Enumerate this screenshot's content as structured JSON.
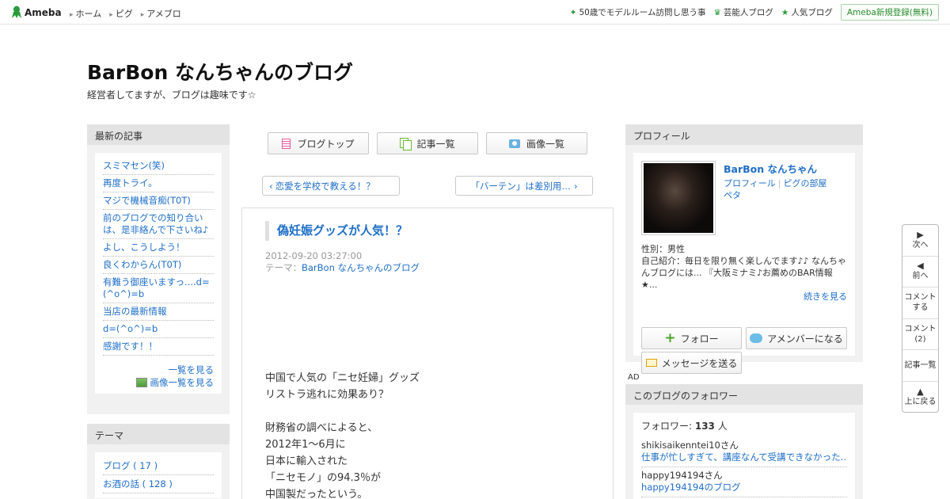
{
  "header": {
    "logo": "Ameba",
    "nav": [
      "ホーム",
      "ピグ",
      "アメブロ"
    ],
    "right_links": [
      "50歳でモデルルーム訪問し思う事",
      "芸能人ブログ",
      "人気ブログ"
    ],
    "register": "Ameba新規登録(無料)"
  },
  "blog": {
    "title": "BarBon なんちゃんのブログ",
    "description": "経営者してますが、ブログは趣味です☆"
  },
  "latest": {
    "heading": "最新の記事",
    "items": [
      "スミマセン(笑)",
      "再度トライ。",
      "マジで機械音痴(T0T)",
      "前のブログでの知り合いは、是非絡んで下さいね♪",
      "よし、こうしよう！",
      "良くわからん(T0T)",
      "有難う御座いますっ....d=(^o^)=b",
      "当店の最新情報",
      "d=(^o^)=b",
      "感謝です！！"
    ],
    "see_list": "一覧を見る",
    "see_images": "画像一覧を見る"
  },
  "theme": {
    "heading": "テーマ",
    "items": [
      "ブログ ( 17 )",
      "お酒の話 ( 128 )"
    ]
  },
  "center": {
    "tabs": [
      "ブログトップ",
      "記事一覧",
      "画像一覧"
    ],
    "prev": "恋愛を学校で教える！？",
    "next": "「バーテン」は差別用…",
    "entry": {
      "title": "偽妊娠グッズが人気！？",
      "date": "2012-09-20 03:27:00",
      "theme_label": "テーマ：",
      "theme": "BarBon なんちゃんのブログ",
      "body": [
        "中国で人気の「ニセ妊婦」グッズ",
        "リストラ逃れに効果あり？",
        "",
        "財務省の調べによると、",
        "2012年1～6月に",
        "日本に輸入された",
        "「ニセモノ」の94.3％が",
        "中国製だったという。"
      ]
    }
  },
  "profile": {
    "heading": "プロフィール",
    "name": "BarBon なんちゃん",
    "link_profile": "プロフィール",
    "link_pig": "ピグの部屋",
    "link_peta": "ペタ",
    "gender": "性別：男性",
    "intro": "自己紹介：毎日を限り無く楽しんでます♪♪ なんちゃんブログには... 『大阪ミナミ♪お薦めのBAR情報★...",
    "more": "続きを見る",
    "follow": "フォロー",
    "amember": "アメンバーになる",
    "message": "メッセージを送る"
  },
  "ad_label": "AD",
  "followers": {
    "heading": "このブログのフォロワー",
    "count_label": "フォロワー: ",
    "count": "133",
    "count_unit": " 人",
    "items": [
      {
        "user": "shikisaikenntei10さん",
        "blog": "仕事が忙しすぎて、講座なんて受講できなかった…"
      },
      {
        "user": "happy194194さん",
        "blog": "happy194194のブログ"
      }
    ]
  },
  "floatnav": {
    "next": "次へ",
    "prev": "前へ",
    "comment1": "コメント",
    "comment2": "する",
    "comments1": "コメント",
    "comments2": "(2)",
    "list": "記事一覧",
    "top": "上に戻る"
  }
}
